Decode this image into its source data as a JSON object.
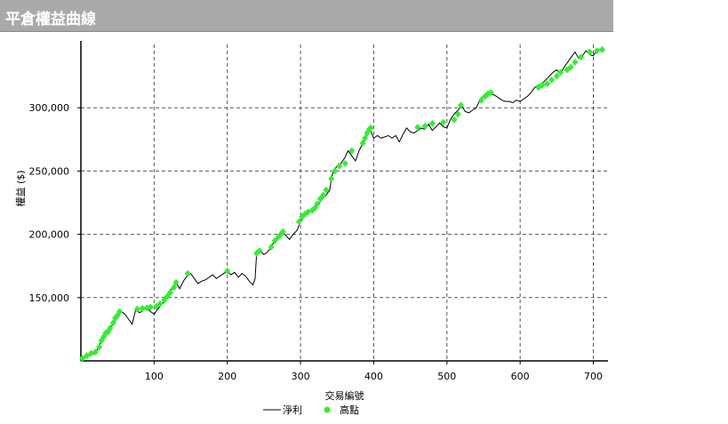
{
  "header": {
    "title": "平倉權益曲線"
  },
  "chart_data": {
    "type": "line",
    "title": "",
    "xlabel": "交易編號",
    "ylabel": "權益 ($)",
    "xlim": [
      0,
      720
    ],
    "ylim": [
      100000,
      350000
    ],
    "x_ticks": [
      100,
      200,
      300,
      400,
      500,
      600,
      700
    ],
    "x_tick_labels": [
      "100",
      "200",
      "300",
      "400",
      "500",
      "600",
      "700"
    ],
    "y_ticks": [
      150000,
      200000,
      250000,
      300000
    ],
    "y_tick_labels": [
      "150,000",
      "200,000",
      "250,000",
      "300,000"
    ],
    "grid": true,
    "legend_position": "bottom",
    "legend": [
      "淨利",
      "高點"
    ],
    "colors": {
      "line": "#000000",
      "highs": "#33ee33",
      "grid": "#555555",
      "title_bar": "#a9a9a9"
    },
    "series": [
      {
        "name": "淨利",
        "x": [
          0,
          5,
          10,
          15,
          20,
          25,
          30,
          35,
          40,
          45,
          50,
          55,
          60,
          65,
          70,
          75,
          80,
          85,
          90,
          95,
          100,
          105,
          110,
          115,
          120,
          125,
          130,
          135,
          140,
          145,
          150,
          155,
          160,
          165,
          170,
          175,
          180,
          185,
          190,
          195,
          200,
          205,
          210,
          215,
          220,
          225,
          230,
          235,
          238,
          240,
          245,
          250,
          255,
          260,
          265,
          270,
          275,
          280,
          285,
          290,
          295,
          300,
          305,
          310,
          315,
          320,
          325,
          330,
          335,
          340,
          342,
          345,
          350,
          355,
          360,
          365,
          370,
          375,
          380,
          385,
          390,
          395,
          400,
          405,
          410,
          415,
          420,
          425,
          430,
          435,
          440,
          445,
          450,
          455,
          460,
          465,
          470,
          475,
          480,
          485,
          490,
          495,
          500,
          505,
          510,
          515,
          520,
          525,
          530,
          535,
          540,
          545,
          550,
          555,
          560,
          565,
          570,
          575,
          580,
          585,
          590,
          595,
          600,
          605,
          610,
          615,
          620,
          625,
          630,
          635,
          640,
          645,
          650,
          655,
          660,
          665,
          670,
          675,
          680,
          685,
          690,
          695,
          700,
          705,
          710,
          715
        ],
        "y": [
          102000,
          103000,
          104000,
          105000,
          106000,
          112000,
          118000,
          123000,
          126000,
          130000,
          134000,
          139000,
          137000,
          133000,
          129000,
          141000,
          138000,
          140000,
          142000,
          139000,
          137000,
          141000,
          144000,
          148000,
          153000,
          158000,
          162000,
          157000,
          163000,
          167000,
          169000,
          165000,
          161000,
          163000,
          164000,
          166000,
          168000,
          165000,
          167000,
          169000,
          171000,
          168000,
          170000,
          166000,
          169000,
          167000,
          163000,
          160000,
          165000,
          185000,
          187000,
          184000,
          186000,
          190000,
          195000,
          198000,
          202000,
          199000,
          196000,
          200000,
          203000,
          210000,
          214000,
          217000,
          219000,
          221000,
          224000,
          228000,
          231000,
          235000,
          244000,
          250000,
          254000,
          256000,
          260000,
          266000,
          262000,
          258000,
          266000,
          272000,
          278000,
          283000,
          276000,
          278000,
          276000,
          277000,
          278000,
          276000,
          278000,
          273000,
          279000,
          284000,
          281000,
          280000,
          282000,
          284000,
          283000,
          287000,
          282000,
          285000,
          288000,
          285000,
          284000,
          291000,
          295000,
          298000,
          302000,
          297000,
          296000,
          298000,
          300000,
          306000,
          309000,
          312000,
          311000,
          310000,
          308000,
          306000,
          305000,
          305000,
          304000,
          306000,
          305000,
          307000,
          309000,
          312000,
          316000,
          318000,
          319000,
          322000,
          325000,
          328000,
          330000,
          327000,
          332000,
          336000,
          340000,
          344000,
          339000,
          341000,
          345000,
          342000,
          341000,
          346000,
          346000,
          345000
        ]
      },
      {
        "name": "高點",
        "x": [
          2,
          8,
          14,
          20,
          25,
          28,
          31,
          34,
          37,
          40,
          44,
          47,
          50,
          53,
          77,
          84,
          90,
          95,
          103,
          108,
          114,
          118,
          122,
          127,
          130,
          146,
          200,
          240,
          244,
          260,
          265,
          270,
          273,
          276,
          298,
          302,
          306,
          310,
          316,
          320,
          323,
          327,
          331,
          335,
          342,
          347,
          353,
          361,
          370,
          385,
          388,
          391,
          394,
          396,
          460,
          470,
          480,
          495,
          510,
          515,
          519,
          547,
          552,
          556,
          560,
          625,
          630,
          637,
          643,
          650,
          655,
          664,
          669,
          675,
          683,
          695,
          705,
          712
        ],
        "y": [
          102000,
          104000,
          106000,
          107000,
          111000,
          116000,
          119000,
          122000,
          123000,
          126000,
          130000,
          134000,
          136000,
          139000,
          141000,
          141500,
          142000,
          142500,
          143000,
          145000,
          148000,
          151000,
          154000,
          158000,
          162000,
          169000,
          171000,
          185000,
          187000,
          190000,
          195000,
          198000,
          200000,
          202000,
          210000,
          214000,
          216000,
          217500,
          219000,
          221000,
          224000,
          228000,
          231000,
          235000,
          244000,
          250000,
          254000,
          256000,
          266000,
          272000,
          276000,
          280000,
          283000,
          284000,
          284500,
          285500,
          287500,
          288500,
          290500,
          295000,
          302000,
          306000,
          309000,
          311000,
          312000,
          316000,
          318000,
          319000,
          322000,
          325000,
          328000,
          330000,
          332000,
          336000,
          340000,
          344000,
          345000,
          346000
        ]
      }
    ]
  }
}
